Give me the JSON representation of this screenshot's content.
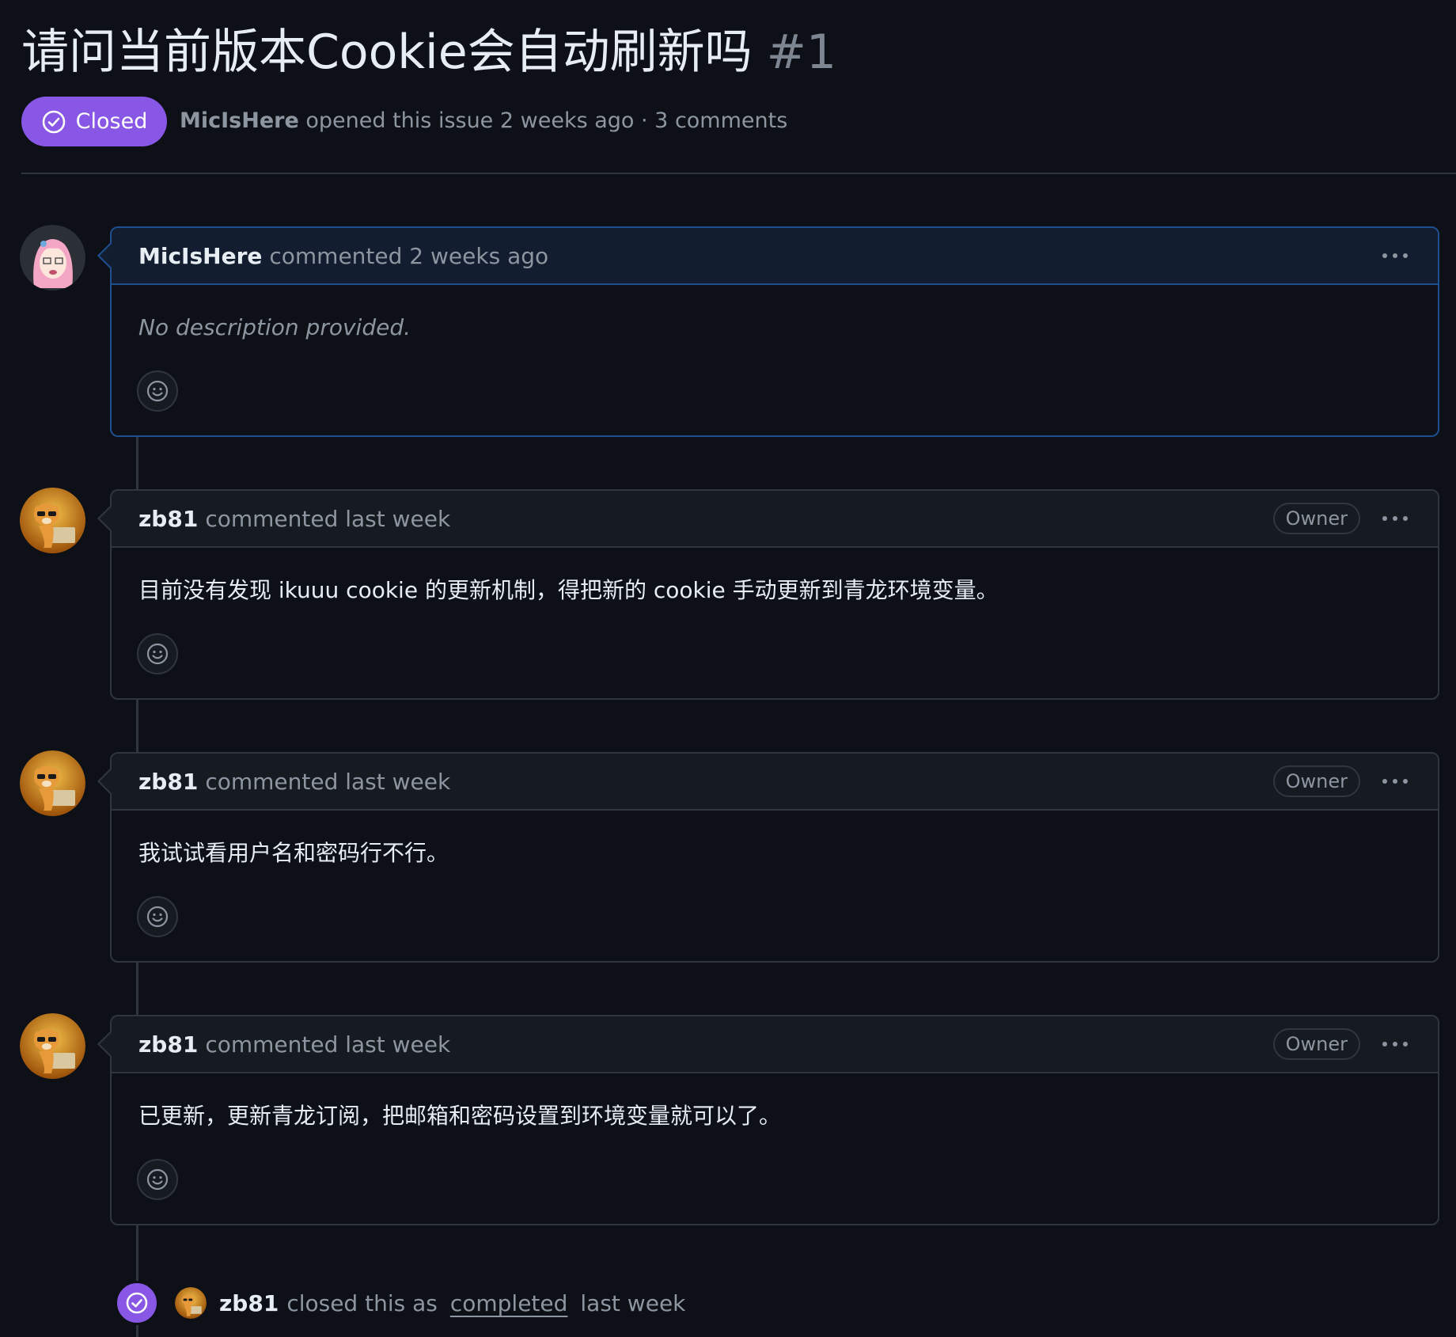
{
  "issue": {
    "title": "请问当前版本Cookie会自动刷新吗",
    "number": "#1",
    "state": "Closed",
    "author": "MicIsHere",
    "opened_text": "opened this issue 2 weeks ago · 3 comments"
  },
  "comments": [
    {
      "author": "MicIsHere",
      "action": "commented 2 weeks ago",
      "role": "",
      "body": "No description provided."
    },
    {
      "author": "zb81",
      "action": "commented last week",
      "role": "Owner",
      "body": "目前没有发现 ikuuu cookie 的更新机制，得把新的 cookie 手动更新到青龙环境变量。"
    },
    {
      "author": "zb81",
      "action": "commented last week",
      "role": "Owner",
      "body": "我试试看用户名和密码行不行。"
    },
    {
      "author": "zb81",
      "action": "commented last week",
      "role": "Owner",
      "body": "已更新，更新青龙订阅，把邮箱和密码设置到环境变量就可以了。"
    }
  ],
  "close_event": {
    "actor": "zb81",
    "text_before": "closed this as",
    "link": "completed",
    "text_after": "last week"
  },
  "icons": {
    "state": "check-circle-icon",
    "reaction": "smiley-icon",
    "menu": "kebab-horizontal-icon"
  },
  "colors": {
    "background": "#0d1117",
    "closed_purple": "#8957e5",
    "author_border": "#1f4f8f"
  }
}
